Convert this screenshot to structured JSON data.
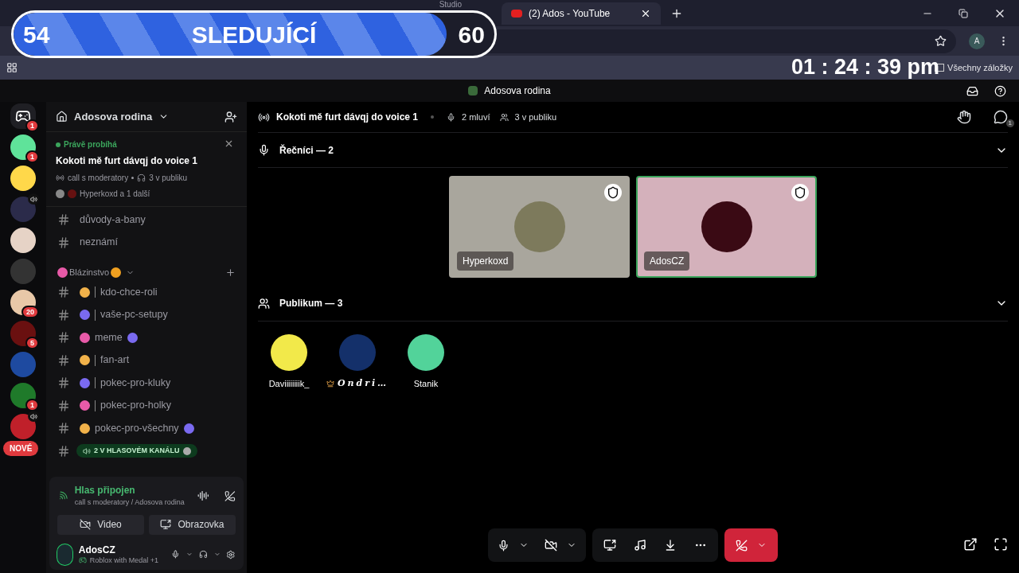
{
  "browser": {
    "tabs": [
      {
        "title": "Studio",
        "selected": false
      },
      {
        "title": "(2) Ados - YouTube",
        "selected": true
      }
    ],
    "profile_initial": "A",
    "all_bookmarks": "Všechny záložky"
  },
  "overlays": {
    "follower_goal": {
      "current": "54",
      "label": "SLEDUJÍCÍ",
      "target": "60",
      "level": 0.9
    },
    "clock": "01 : 24 : 39 pm"
  },
  "title_bar": {
    "title": "Adosova rodina"
  },
  "servers": [
    {
      "kind": "home",
      "badge": "1",
      "voice": false
    },
    {
      "kind": "avatar",
      "badge": "1",
      "voice": false
    },
    {
      "kind": "avatar",
      "voice": false
    },
    {
      "kind": "avatar",
      "voice": true
    },
    {
      "kind": "avatar",
      "voice": false
    },
    {
      "kind": "avatar",
      "voice": false
    },
    {
      "kind": "avatar",
      "badge": "20",
      "voice": false
    },
    {
      "kind": "avatar",
      "badge": "5",
      "voice": false
    },
    {
      "kind": "avatar",
      "voice": false
    },
    {
      "kind": "avatar",
      "badge": "1",
      "voice": false
    },
    {
      "kind": "avatar",
      "voice": true
    }
  ],
  "new_pill": "NOVÉ",
  "sidebar": {
    "server_name": "Adosova rodina",
    "event": {
      "status": "Právě probíhá",
      "title": "Kokoti mě furt dávqj do voice 1",
      "channel": "call s moderatory",
      "audience": "3 v publiku",
      "participants": "Hyperkoxd a 1 další"
    },
    "channels": [
      {
        "kind": "channel",
        "name": "důvody-a-bany",
        "emoji": false,
        "separator": false,
        "trailing_emoji": false
      },
      {
        "kind": "channel",
        "name": "neznámí",
        "emoji": false,
        "separator": false,
        "trailing_emoji": false
      },
      {
        "kind": "category",
        "name": "Blázinstvo",
        "expanded": true
      },
      {
        "kind": "channel",
        "name": "kdo-chce-roli",
        "emoji": true,
        "separator": true,
        "trailing_emoji": false
      },
      {
        "kind": "channel",
        "name": "vaše-pc-setupy",
        "emoji": true,
        "separator": true,
        "trailing_emoji": false
      },
      {
        "kind": "channel",
        "name": "meme",
        "emoji": true,
        "separator": false,
        "trailing_emoji": true
      },
      {
        "kind": "channel",
        "name": "fan-art",
        "emoji": true,
        "separator": true,
        "trailing_emoji": false
      },
      {
        "kind": "channel",
        "name": "pokec-pro-kluky",
        "emoji": true,
        "separator": true,
        "trailing_emoji": false
      },
      {
        "kind": "channel",
        "name": "pokec-pro-holky",
        "emoji": true,
        "separator": true,
        "trailing_emoji": false
      },
      {
        "kind": "channel",
        "name": "pokec-pro-všechny",
        "emoji": true,
        "separator": false,
        "trailing_emoji": true
      },
      {
        "kind": "voice_pill",
        "name": "2 V HLASOVÉM KANÁLU"
      }
    ],
    "voice_panel": {
      "status": "Hlas připojen",
      "location": "call s moderatory / Adosova rodina",
      "video": "Video",
      "screen": "Obrazovka"
    },
    "user": {
      "name": "AdosCZ",
      "activity": "Roblox with Medal +1"
    }
  },
  "stage": {
    "title": "Kokoti mě furt dávqj do voice 1",
    "speaking": "2 mluví",
    "audience": "3 v publiku",
    "chat_badge": "1",
    "speakers_section": {
      "title": "Řečníci — 2",
      "expanded": true
    },
    "speakers": [
      {
        "name": "Hyperkoxd",
        "speaking": false,
        "color": "#a9a69d"
      },
      {
        "name": "AdosCZ",
        "speaking": true,
        "color": "#d4b1bb"
      }
    ],
    "audience_section": {
      "title": "Publikum — 3",
      "expanded": true
    },
    "audience_members": [
      {
        "name": "Daviiiiiiiik_",
        "crown": false,
        "fancy": false
      },
      {
        "name": "Ondri…",
        "crown": true,
        "fancy": true
      },
      {
        "name": "Stanik",
        "crown": false,
        "fancy": false
      }
    ]
  }
}
